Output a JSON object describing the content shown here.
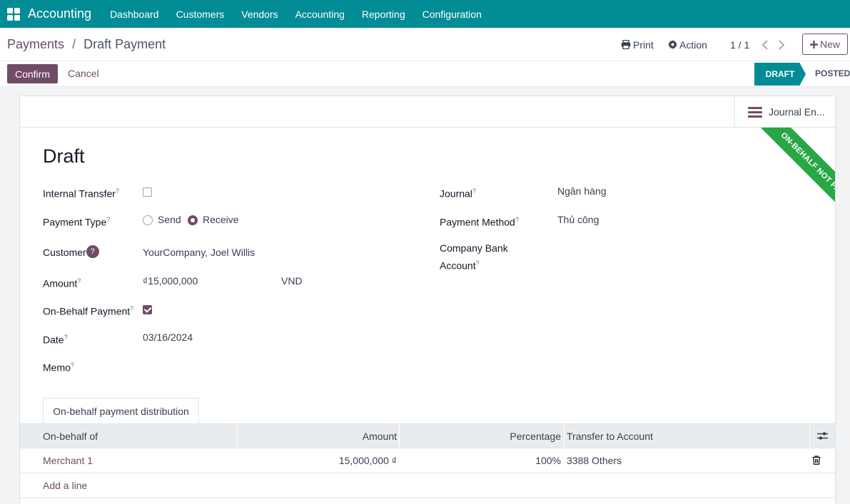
{
  "navbar": {
    "brand": "Accounting",
    "items": [
      "Dashboard",
      "Customers",
      "Vendors",
      "Accounting",
      "Reporting",
      "Configuration"
    ]
  },
  "breadcrumb": {
    "parent": "Payments",
    "separator": "/",
    "current": "Draft Payment"
  },
  "control": {
    "print_label": "Print",
    "action_label": "Action",
    "pager": "1 / 1",
    "new_label": "New"
  },
  "statusbar": {
    "confirm_label": "Confirm",
    "cancel_label": "Cancel",
    "stages": [
      "DRAFT",
      "POSTED"
    ],
    "active_stage": "DRAFT"
  },
  "sheet": {
    "journal_entry_button": "Journal En...",
    "ribbon": "ON-BEHALF NOT PAID",
    "title": "Draft"
  },
  "fields": {
    "internal_transfer": {
      "label": "Internal Transfer",
      "help": "?",
      "checked": false
    },
    "payment_type": {
      "label": "Payment Type",
      "help": "?",
      "options": [
        "Send",
        "Receive"
      ],
      "selected": "Receive"
    },
    "customer": {
      "label": "Customer",
      "help": "?",
      "value": "YourCompany, Joel Willis"
    },
    "amount": {
      "label": "Amount",
      "help": "?",
      "value": "₫15,000,000",
      "currency": "VND"
    },
    "on_behalf_payment": {
      "label": "On-Behalf Payment",
      "help": "?",
      "checked": true
    },
    "date": {
      "label": "Date",
      "help": "?",
      "value": "03/16/2024"
    },
    "memo": {
      "label": "Memo",
      "help": "?",
      "value": ""
    },
    "journal": {
      "label": "Journal",
      "help": "?",
      "value": "Ngân hàng"
    },
    "payment_method": {
      "label": "Payment Method",
      "help": "?",
      "value": "Thủ công"
    },
    "company_bank_account": {
      "label_line1": "Company Bank",
      "label_line2": "Account",
      "help": "?",
      "value": ""
    }
  },
  "tab": {
    "label": "On-behalf payment distribution"
  },
  "table": {
    "columns": [
      "On-behalf of",
      "Amount",
      "Percentage",
      "Transfer to Account"
    ],
    "rows": [
      {
        "on_behalf_of": "Merchant 1",
        "amount": "15,000,000 ₫",
        "percentage": "100%",
        "transfer_to_account": "3388 Others"
      }
    ],
    "add_line_label": "Add a line"
  },
  "colors": {
    "navbar": "#018c96",
    "primary": "#714b67",
    "ribbon": "#28a745"
  },
  "icons": [
    "apps-grid-icon",
    "printer-icon",
    "gear-icon",
    "chevron-left-icon",
    "chevron-right-icon",
    "plus-icon",
    "hamburger-list-icon",
    "column-settings-icon",
    "trash-icon"
  ]
}
